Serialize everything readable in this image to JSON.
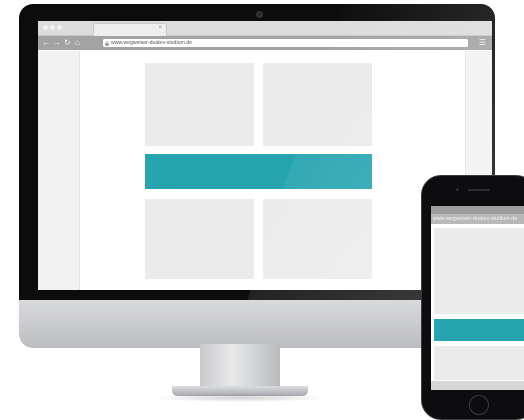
{
  "desktop": {
    "browser": {
      "tab_close_glyph": "×",
      "nav": {
        "back": "←",
        "forward": "→",
        "reload": "↻",
        "home": "⌂"
      },
      "url": "www.wegweiser-duales-studium.de",
      "menu_glyph": "☰"
    }
  },
  "mobile": {
    "status_text": "",
    "url": "www.wegweiser-duales-studium.de"
  },
  "colors": {
    "accent": "#26a4b0",
    "placeholder": "#ebebeb",
    "bezel": "#0c0c0d"
  },
  "icons": [
    "camera-icon",
    "back-arrow-icon",
    "forward-arrow-icon",
    "reload-icon",
    "home-icon",
    "lock-icon",
    "menu-icon",
    "home-button-icon"
  ]
}
